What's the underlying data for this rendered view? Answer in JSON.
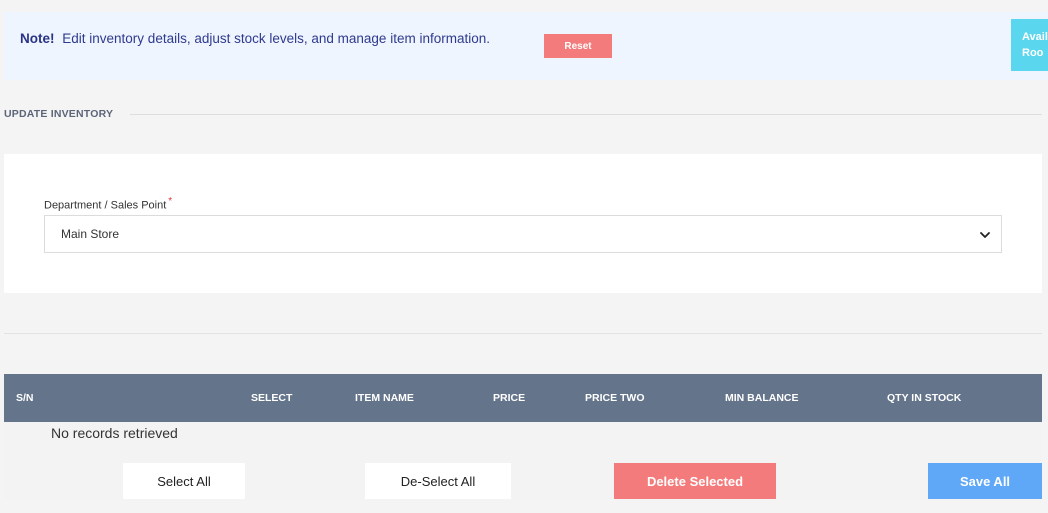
{
  "note": {
    "strong": "Note!",
    "text": "Edit inventory details, adjust stock levels, and manage item information.",
    "reset_label": "Reset",
    "side_button_line1": "Avail",
    "side_button_line2": "Roo"
  },
  "section": {
    "title": "UPDATE INVENTORY"
  },
  "form": {
    "department_label": "Department / Sales Point",
    "required_mark": "*",
    "department_value": "Main Store"
  },
  "table": {
    "columns": [
      "S/N",
      "SELECT",
      "ITEM NAME",
      "PRICE",
      "PRICE TWO",
      "MIN BALANCE",
      "QTY IN STOCK"
    ],
    "empty_message": "No records retrieved"
  },
  "actions": {
    "select_all": "Select All",
    "deselect_all": "De-Select All",
    "delete_selected": "Delete Selected",
    "save_all": "Save All"
  },
  "colors": {
    "accent_red": "#f47b7b",
    "accent_blue": "#5fa7f7",
    "accent_cyan": "#5ad6ee",
    "table_header": "#64748b"
  },
  "icons": {
    "select_chevron": "chevron-down-icon"
  }
}
